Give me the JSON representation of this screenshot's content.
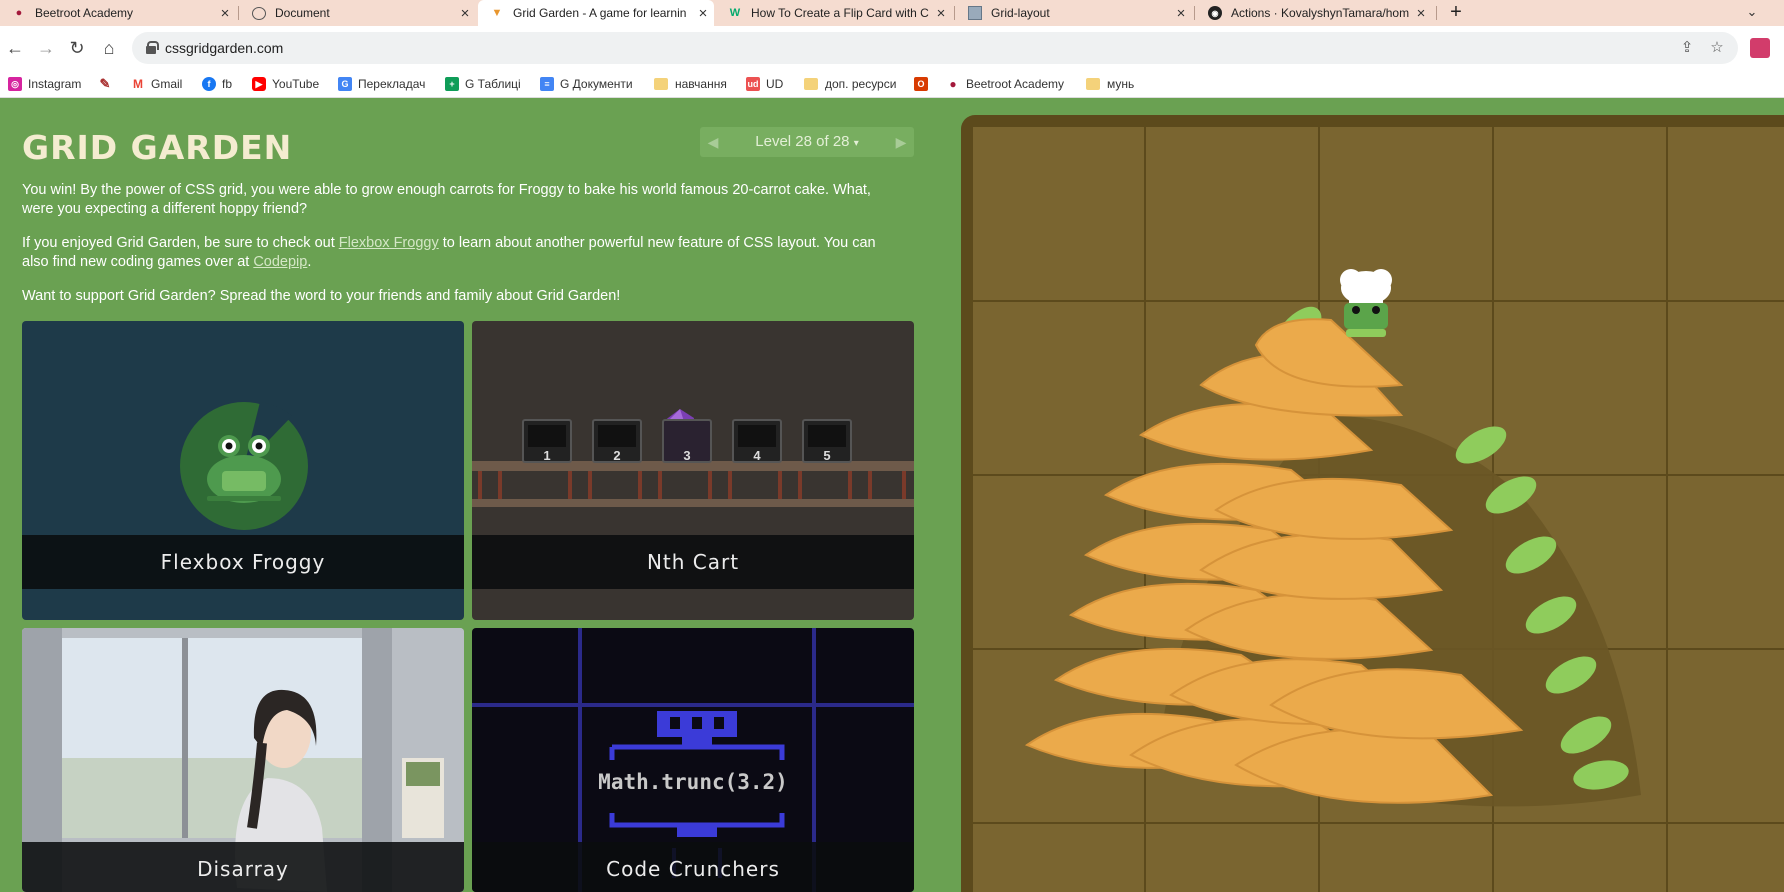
{
  "browser": {
    "tabs": [
      {
        "title": "Beetroot Academy",
        "favicon": "beetroot-icon"
      },
      {
        "title": "Document",
        "favicon": "globe-icon"
      },
      {
        "title": "Grid Garden - A game for learnin",
        "favicon": "carrot-icon",
        "active": true
      },
      {
        "title": "How To Create a Flip Card with C",
        "favicon": "w3schools-icon"
      },
      {
        "title": "Grid-layout",
        "favicon": "grid-page-icon"
      },
      {
        "title": "Actions · KovalyshynTamara/hom",
        "favicon": "github-icon"
      }
    ],
    "url": "cssgridgarden.com",
    "bookmarks": [
      {
        "label": "Instagram",
        "icon": "instagram-icon",
        "color": "#d6249f"
      },
      {
        "label": "",
        "icon": "feather-icon",
        "color": "#a33"
      },
      {
        "label": "Gmail",
        "icon": "gmail-icon",
        "color": "#ea4335"
      },
      {
        "label": "fb",
        "icon": "facebook-icon",
        "color": "#1877f2"
      },
      {
        "label": "YouTube",
        "icon": "youtube-icon",
        "color": "#ff0000"
      },
      {
        "label": "Перекладач",
        "icon": "translate-icon",
        "color": "#4285f4"
      },
      {
        "label": "G Таблиці",
        "icon": "sheets-icon",
        "color": "#0f9d58"
      },
      {
        "label": "G Документи",
        "icon": "docs-icon",
        "color": "#4285f4"
      },
      {
        "label": "навчання",
        "icon": "folder-icon"
      },
      {
        "label": "UD",
        "icon": "udemy-icon",
        "color": "#ec5252"
      },
      {
        "label": "доп. ресурси",
        "icon": "folder-icon"
      },
      {
        "label": "",
        "icon": "office-icon",
        "color": "#d83b01"
      },
      {
        "label": "Beetroot Academy",
        "icon": "beetroot-icon",
        "color": "#a3193b"
      },
      {
        "label": "мунь",
        "icon": "folder-icon"
      }
    ]
  },
  "page": {
    "title": "GRID GARDEN",
    "level_label": "Level 28 of 28",
    "level_caret": "▾",
    "paragraph1": "You win! By the power of CSS grid, you were able to grow enough carrots for Froggy to bake his world famous 20-carrot cake. What, were you expecting a different hoppy friend?",
    "paragraph2_before": "If you enjoyed Grid Garden, be sure to check out ",
    "paragraph2_link1": "Flexbox Froggy",
    "paragraph2_middle": " to learn about another powerful new feature of CSS layout. You can also find new coding games over at ",
    "paragraph2_link2": "Codepip",
    "paragraph2_after": ".",
    "paragraph3": "Want to support Grid Garden? Spread the word to your friends and family about Grid Garden!",
    "cards": [
      {
        "label": "Flexbox Froggy"
      },
      {
        "label": "Nth Cart",
        "cart_numbers": [
          "1",
          "2",
          "3",
          "4",
          "5"
        ]
      },
      {
        "label": "Disarray"
      },
      {
        "label": "Code Crunchers",
        "code_text": "Math.trunc(3.2)"
      }
    ]
  }
}
